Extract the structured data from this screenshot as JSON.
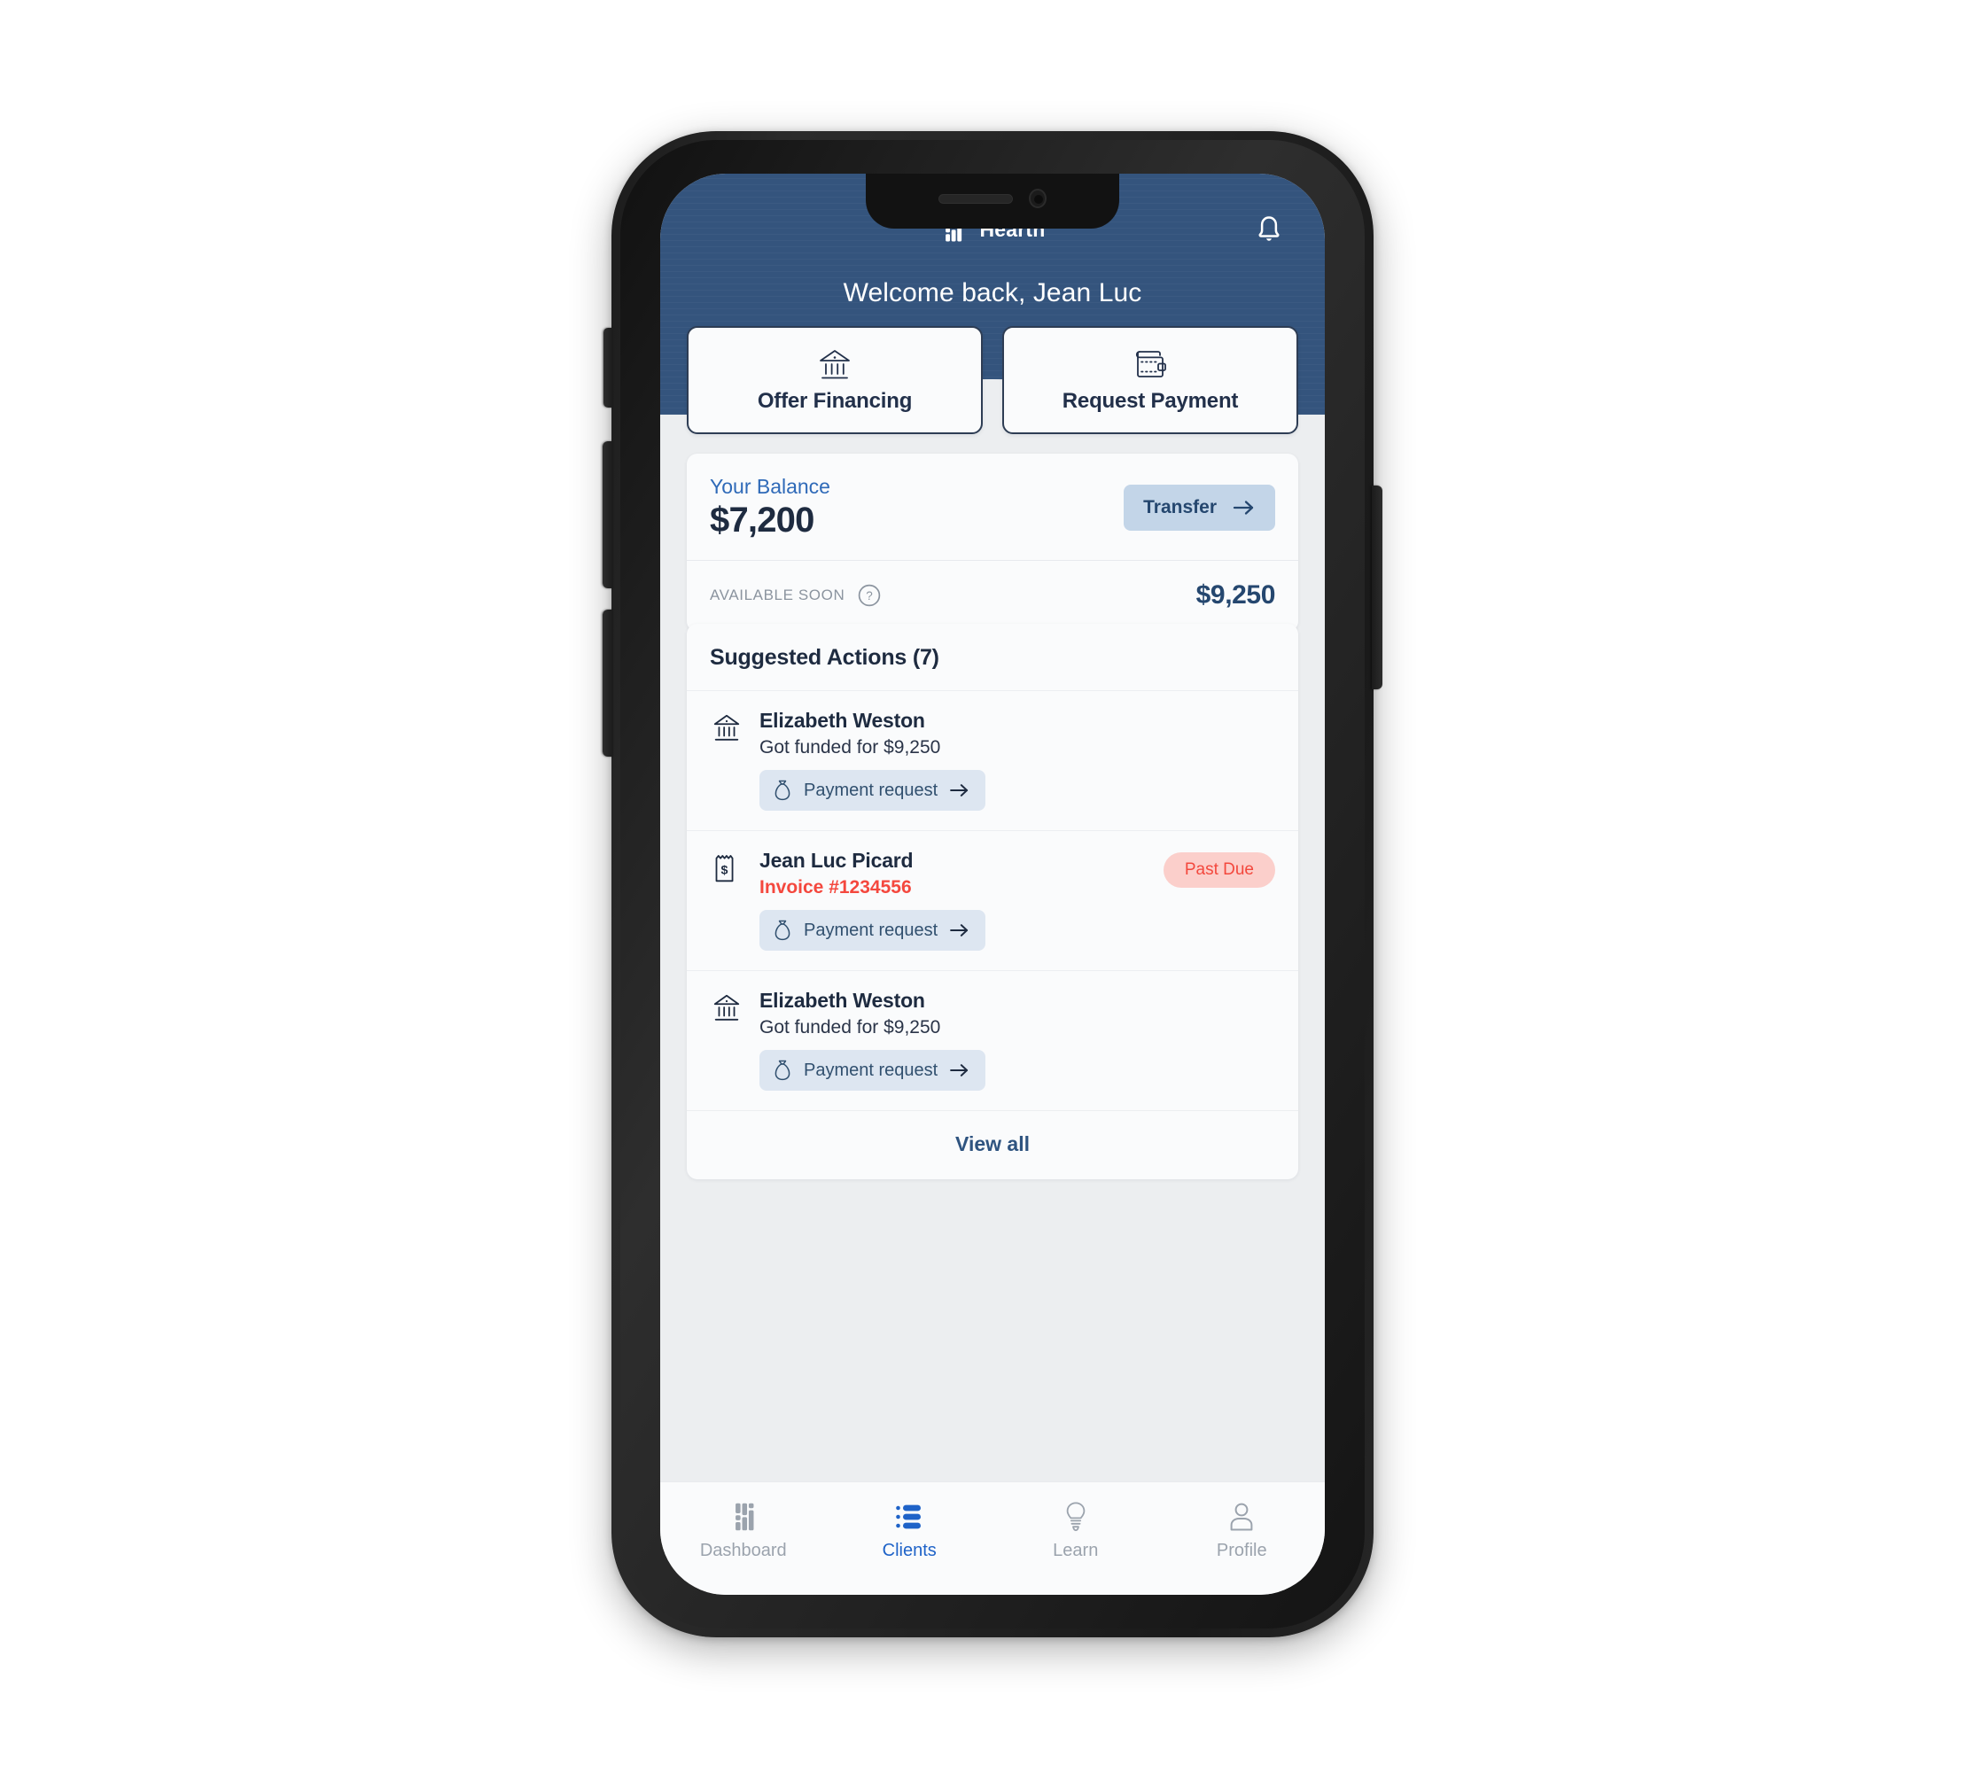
{
  "app": {
    "brand_name": "Hearth",
    "welcome_text": "Welcome back, Jean Luc",
    "notification_icon": "bell-icon",
    "logo_icon": "hearth-logo-icon"
  },
  "quick_actions": [
    {
      "label": "Offer Financing",
      "icon": "bank-icon"
    },
    {
      "label": "Request Payment",
      "icon": "wallet-icon"
    }
  ],
  "balance": {
    "label": "Your Balance",
    "amount": "$7,200",
    "transfer_label": "Transfer",
    "transfer_icon": "arrow-right-icon",
    "available_label": "AVAILABLE SOON",
    "help_icon": "question-circle-icon",
    "available_amount": "$9,250"
  },
  "suggested": {
    "title": "Suggested Actions (7)",
    "view_all_label": "View all",
    "items": [
      {
        "icon": "bank-icon",
        "name": "Elizabeth Weston",
        "subtitle": "Got funded for $9,250",
        "subtitle_style": "normal",
        "chip_label": "Payment request",
        "chip_icon": "money-bag-icon",
        "chip_arrow": "arrow-right-icon",
        "badge": null
      },
      {
        "icon": "invoice-icon",
        "name": "Jean Luc Picard",
        "subtitle": "Invoice #1234556",
        "subtitle_style": "danger",
        "chip_label": "Payment request",
        "chip_icon": "money-bag-icon",
        "chip_arrow": "arrow-right-icon",
        "badge": "Past Due"
      },
      {
        "icon": "bank-icon",
        "name": "Elizabeth Weston",
        "subtitle": "Got funded for $9,250",
        "subtitle_style": "normal",
        "chip_label": "Payment request",
        "chip_icon": "money-bag-icon",
        "chip_arrow": "arrow-right-icon",
        "badge": null
      }
    ]
  },
  "bottom_nav": {
    "items": [
      {
        "label": "Dashboard",
        "icon": "hearth-logo-icon",
        "active": false
      },
      {
        "label": "Clients",
        "icon": "list-icon",
        "active": true
      },
      {
        "label": "Learn",
        "icon": "lightbulb-icon",
        "active": false
      },
      {
        "label": "Profile",
        "icon": "person-icon",
        "active": false
      }
    ]
  },
  "colors": {
    "header_blue": "#34547d",
    "accent_blue": "#2f6ab8",
    "navy": "#1e2b40",
    "danger_red": "#f4483e",
    "badge_bg": "#fbcfcb",
    "chip_bg": "#dde6f1",
    "transfer_bg": "#c3d5e8",
    "page_bg": "#eceef0",
    "card_bg": "#fafbfc"
  }
}
